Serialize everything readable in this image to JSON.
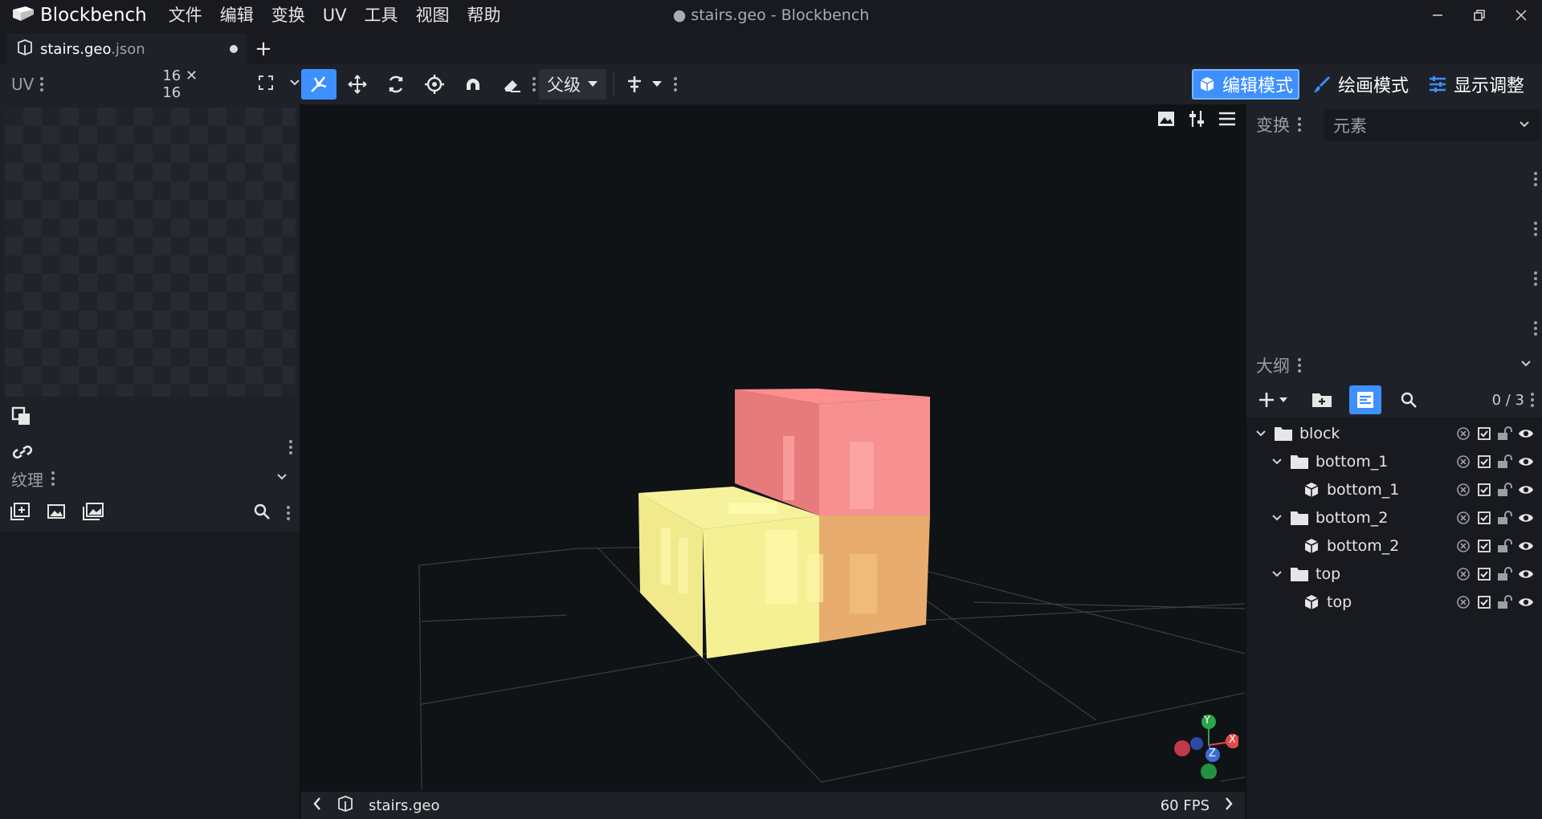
{
  "app": {
    "name": "Blockbench",
    "window_title": "● stairs.geo - Blockbench",
    "menu": [
      "文件",
      "编辑",
      "变换",
      "UV",
      "工具",
      "视图",
      "帮助"
    ]
  },
  "tab": {
    "name": "stairs.geo",
    "ext": ".json",
    "add": "+"
  },
  "uv_panel": {
    "title": "UV",
    "size": "16 ✕ 16"
  },
  "toolbar": {
    "parent_dropdown": "父级"
  },
  "modes": [
    {
      "label": "编辑模式",
      "icon": "cube-icon",
      "active": true
    },
    {
      "label": "绘画模式",
      "icon": "brush-icon",
      "active": false
    },
    {
      "label": "显示调整",
      "icon": "sliders-icon",
      "active": false
    }
  ],
  "textures_panel": {
    "title": "纹理"
  },
  "transform_panel": {
    "title": "变换",
    "element_label": "元素"
  },
  "outliner": {
    "title": "大纲",
    "count": "0 / 3",
    "nodes": [
      {
        "label": "block",
        "type": "folder",
        "depth": 0
      },
      {
        "label": "bottom_1",
        "type": "folder",
        "depth": 1
      },
      {
        "label": "bottom_1",
        "type": "cube",
        "depth": 2
      },
      {
        "label": "bottom_2",
        "type": "folder",
        "depth": 1
      },
      {
        "label": "bottom_2",
        "type": "cube",
        "depth": 2
      },
      {
        "label": "top",
        "type": "folder",
        "depth": 1
      },
      {
        "label": "top",
        "type": "cube",
        "depth": 2
      }
    ]
  },
  "viewport": {
    "gizmo_axes": [
      "Y",
      "X",
      "Z"
    ]
  },
  "statusbar": {
    "file": "stairs.geo",
    "fps": "60 FPS"
  },
  "colors": {
    "accent": "#3e90ff",
    "pink": "#ff9b9b",
    "yellow": "#f2ee95",
    "orange": "#e6ad6b"
  }
}
